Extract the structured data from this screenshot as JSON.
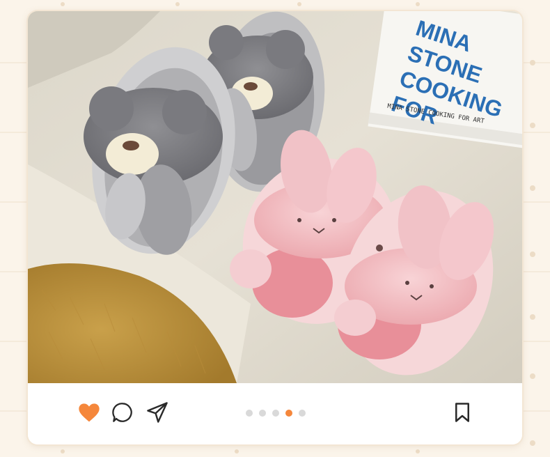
{
  "photo": {
    "description_alt": "Plush bear and bunny slippers on a sofa",
    "book": {
      "title_lines": [
        "MINA",
        "STONE",
        "COOKING",
        "FOR"
      ],
      "spine_text": "MINA STONE COOKING FOR ART"
    }
  },
  "actions": {
    "like_icon": "heart-icon",
    "comment_icon": "comment-icon",
    "share_icon": "send-icon",
    "bookmark_icon": "bookmark-icon",
    "liked": true
  },
  "pagination": {
    "total": 5,
    "current": 4
  },
  "colors": {
    "accent": "#f5873b",
    "dot_inactive": "#d9d9d9",
    "book_text": "#2b6fb5",
    "background": "#fbf4ea"
  }
}
